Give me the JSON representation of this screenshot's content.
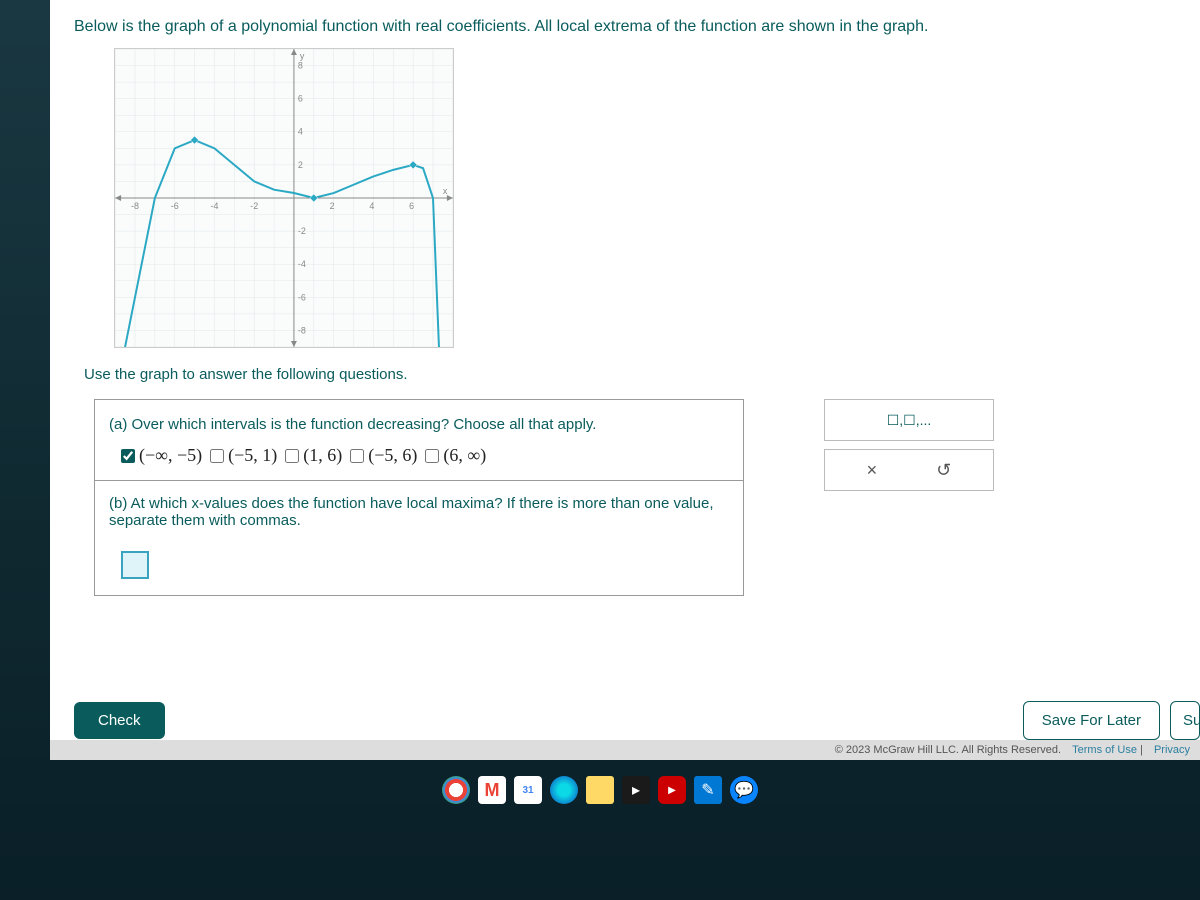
{
  "intro": "Below is the graph of a polynomial function with real coefficients. All local extrema of the function are shown in the graph.",
  "subtext": "Use the graph to answer the following questions.",
  "question_a": {
    "text": "(a) Over which intervals is the function decreasing? Choose all that apply.",
    "options": [
      {
        "label": "(−∞, −5)",
        "checked": true
      },
      {
        "label": "(−5, 1)",
        "checked": false
      },
      {
        "label": "(1, 6)",
        "checked": false
      },
      {
        "label": "(−5, 6)",
        "checked": false
      },
      {
        "label": "(6, ∞)",
        "checked": false
      }
    ]
  },
  "question_b": {
    "text": "(b) At which x-values does the function have local maxima? If there is more than one value, separate them with commas."
  },
  "side_panel": {
    "format": "☐,☐,...",
    "clear": "×",
    "undo": "↺"
  },
  "buttons": {
    "check": "Check",
    "save": "Save For Later",
    "submit": "Sub"
  },
  "copyright": {
    "text": "© 2023 McGraw Hill LLC. All Rights Reserved.",
    "terms": "Terms of Use",
    "privacy": "Privacy"
  },
  "chart_data": {
    "type": "line",
    "title": "",
    "xlabel": "x",
    "ylabel": "y",
    "xlim": [
      -9,
      8
    ],
    "ylim": [
      -9,
      9
    ],
    "x_ticks": [
      -8,
      -6,
      -4,
      -2,
      2,
      4,
      6
    ],
    "y_ticks": [
      -8,
      -6,
      -4,
      -2,
      2,
      4,
      6,
      8
    ],
    "series": [
      {
        "name": "polynomial",
        "x": [
          -8.5,
          -8,
          -7,
          -6,
          -5,
          -4,
          -3,
          -2,
          -1,
          0,
          1,
          2,
          3,
          4,
          5,
          6,
          6.5,
          7,
          7.3
        ],
        "values": [
          -9,
          -6,
          0,
          3,
          3.5,
          3,
          2,
          1,
          0.5,
          0.3,
          0,
          0.3,
          0.8,
          1.3,
          1.7,
          2,
          1.8,
          0,
          -9
        ]
      }
    ],
    "extrema_points": [
      {
        "x": -5,
        "y": 3.5,
        "type": "max"
      },
      {
        "x": 1,
        "y": 0,
        "type": "min"
      },
      {
        "x": 6,
        "y": 2,
        "type": "max"
      }
    ]
  },
  "taskbar_items": [
    "chrome",
    "gmail",
    "calendar",
    "edge",
    "folder",
    "video",
    "youtube",
    "snip",
    "chat"
  ]
}
